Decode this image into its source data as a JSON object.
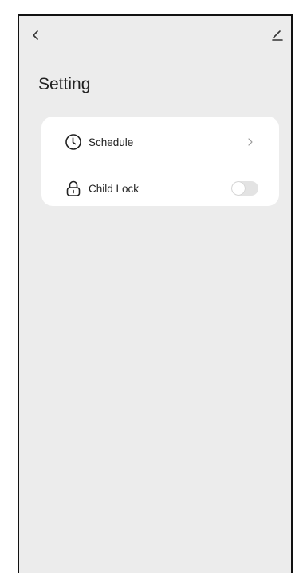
{
  "header": {
    "back_icon": "chevron-left-icon",
    "edit_icon": "pencil-icon"
  },
  "page": {
    "title": "Setting"
  },
  "settings": {
    "items": [
      {
        "label": "Schedule",
        "icon": "clock-icon",
        "control": "chevron-right-icon"
      },
      {
        "label": "Child Lock",
        "icon": "lock-icon",
        "control": "toggle",
        "toggle_on": false
      }
    ]
  },
  "colors": {
    "background": "#ececec",
    "card": "#ffffff",
    "text": "#222222",
    "toggle_off": "#e3e3e3"
  }
}
